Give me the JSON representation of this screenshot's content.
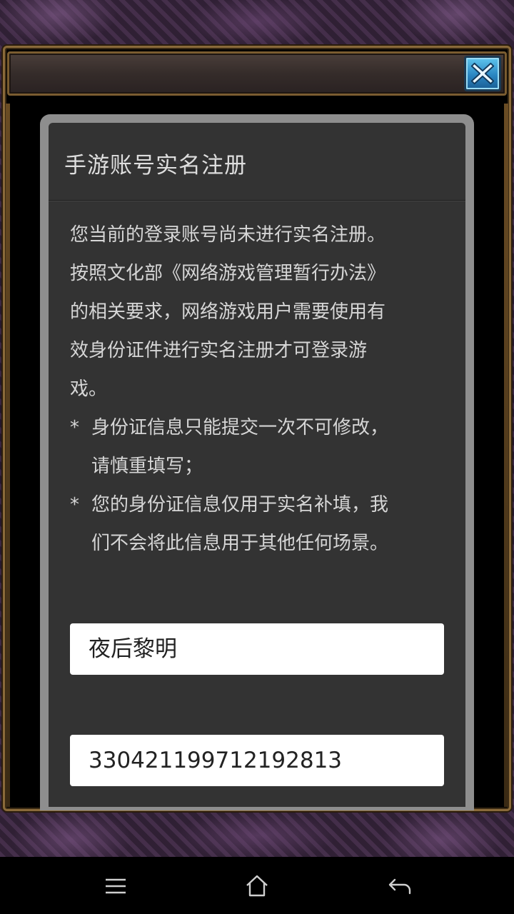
{
  "dialog": {
    "title": "手游账号实名注册",
    "intro_lines": [
      "您当前的登录账号尚未进行实名注册。",
      "按照文化部《网络游戏管理暂行办法》",
      "的相关要求，网络游戏用户需要使用有",
      "效身份证件进行实名注册才可登录游",
      "戏。"
    ],
    "notes": [
      {
        "bullet": "*",
        "lines": [
          "身份证信息只能提交一次不可修改，",
          "请慎重填写；"
        ]
      },
      {
        "bullet": "*",
        "lines": [
          "您的身份证信息仅用于实名补填，我",
          "们不会将此信息用于其他任何场景。"
        ]
      }
    ],
    "name_field": {
      "value": "夜后黎明"
    },
    "id_field": {
      "value": "330421199712192813"
    }
  },
  "window": {
    "close_icon": "close-x-icon"
  },
  "navbar": {
    "icons": [
      "menu-icon",
      "home-icon",
      "back-icon"
    ]
  },
  "colors": {
    "close_button": "#2a86c2",
    "dialog_bg": "#333333",
    "frame_gold": "#8a6a3a"
  }
}
